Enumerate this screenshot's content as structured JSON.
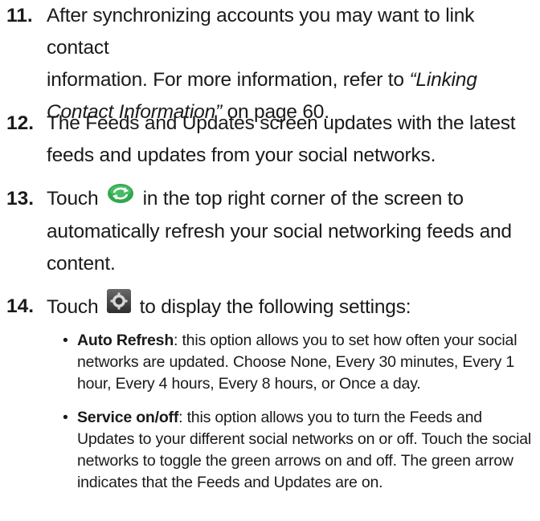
{
  "steps": {
    "s11": {
      "num": "11.",
      "line1": "After synchronizing accounts you may want to link contact",
      "line2a": "information. For more information, refer to ",
      "ref_title_a": "“Linking",
      "ref_title_b": "Contact Information”",
      "line3b": " on page 60."
    },
    "s12": {
      "num": "12.",
      "line1": "The Feeds and Updates screen updates with the latest",
      "line2": "feeds and updates from your social networks."
    },
    "s13": {
      "num": "13.",
      "before_icon": "Touch ",
      "after_icon": " in the top right corner of the screen to",
      "line2": "automatically refresh your social networking feeds and",
      "line3": "content.",
      "icon": "refresh-icon",
      "icon_color": "#2fa84f"
    },
    "s14": {
      "num": "14.",
      "before_icon": "Touch ",
      "after_icon": " to display the following settings:",
      "icon": "settings-gear-icon",
      "icon_color": "#4a4a4a"
    }
  },
  "bullets": [
    {
      "term": "Auto Refresh",
      "lines": [
        ": this option allows you to set how often your social",
        "networks are updated. Choose None, Every 30 minutes, Every 1",
        "hour, Every 4 hours, Every 8 hours, or Once a day."
      ]
    },
    {
      "term": "Service on/off",
      "lines": [
        ": this option allows you to turn the Feeds and",
        "Updates to your different social networks on or off. Touch the social",
        "networks to toggle the green arrows on and off. The green arrow",
        "indicates that the Feeds and Updates are on."
      ]
    }
  ],
  "bullet_glyph": "•"
}
